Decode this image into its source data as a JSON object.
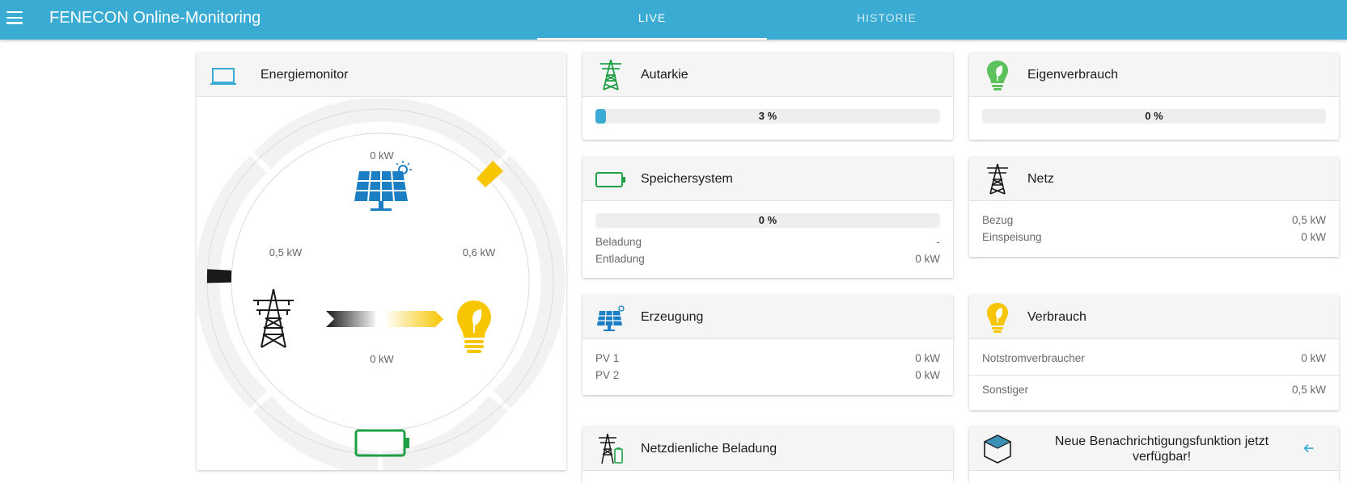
{
  "header": {
    "title": "FENECON Online-Monitoring",
    "tabs": [
      {
        "label": "LIVE",
        "active": true
      },
      {
        "label": "HISTORIE",
        "active": false
      }
    ]
  },
  "colors": {
    "primary": "#3aacd4",
    "battery_green": "#1ea044",
    "consumption_yellow": "#f7c600",
    "grid_black": "#1a1a1a",
    "solar_blue": "#1c7fc4"
  },
  "energiemonitor": {
    "title": "Energiemonitor",
    "icon": "laptop-icon",
    "production_value": "0 kW",
    "grid_value": "0,5 kW",
    "consumption_value": "0,6 kW",
    "storage_value": "0 kW"
  },
  "autarkie": {
    "title": "Autarkie",
    "icon": "grid-tower-icon",
    "percent": 3,
    "percent_label": "3 %"
  },
  "eigenverbrauch": {
    "title": "Eigenverbrauch",
    "icon": "leaf-bulb-icon",
    "percent": 0,
    "percent_label": "0 %"
  },
  "speichersystem": {
    "title": "Speichersystem",
    "icon": "battery-icon",
    "percent": 0,
    "percent_label": "0 %",
    "rows": [
      {
        "label": "Beladung",
        "value": "-"
      },
      {
        "label": "Entladung",
        "value": "0 kW"
      }
    ]
  },
  "netz": {
    "title": "Netz",
    "icon": "grid-tower-icon",
    "rows": [
      {
        "label": "Bezug",
        "value": "0,5 kW"
      },
      {
        "label": "Einspeisung",
        "value": "0 kW"
      }
    ]
  },
  "erzeugung": {
    "title": "Erzeugung",
    "icon": "solar-panel-icon",
    "rows": [
      {
        "label": "PV 1",
        "value": "0 kW"
      },
      {
        "label": "PV 2",
        "value": "0 kW"
      }
    ]
  },
  "verbrauch": {
    "title": "Verbrauch",
    "icon": "bulb-icon",
    "rows": [
      {
        "label": "Notstromverbraucher",
        "value": "0 kW"
      },
      {
        "label": "Sonstiger",
        "value": "0,5 kW"
      }
    ]
  },
  "netzdienliche": {
    "title": "Netzdienliche Beladung",
    "icon": "grid-battery-icon"
  },
  "notification": {
    "title": "Neue Benachrichtigungsfunktion jetzt verfügbar!",
    "icon": "cube-icon",
    "action_icon": "arrow-left-icon"
  }
}
